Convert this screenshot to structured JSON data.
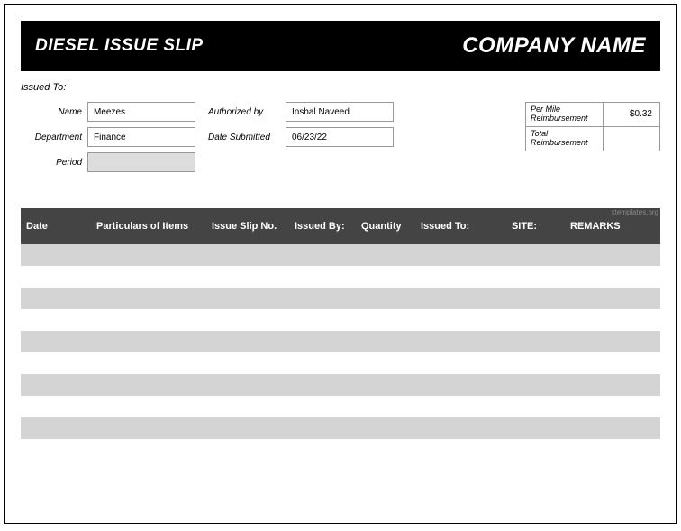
{
  "header": {
    "title": "DIESEL ISSUE SLIP",
    "company": "COMPANY NAME"
  },
  "issued_to_label": "Issued To:",
  "fields": {
    "name_label": "Name",
    "name_value": "Meezes",
    "department_label": "Department",
    "department_value": "Finance",
    "period_label": "Period",
    "period_value": "",
    "authorized_label": "Authorized by",
    "authorized_value": "Inshal Naveed",
    "date_submitted_label": "Date Submitted",
    "date_submitted_value": "06/23/22"
  },
  "reimbursement": {
    "per_mile_label": "Per Mile Reimbursement",
    "per_mile_value": "$0.32",
    "total_label": "Total Reimbursement",
    "total_value": ""
  },
  "watermark": "xtemplates.org",
  "table": {
    "headers": {
      "date": "Date",
      "particulars": "Particulars of Items",
      "slip_no": "Issue Slip No.",
      "issued_by": "Issued By:",
      "quantity": "Quantity",
      "issued_to": "Issued To:",
      "site": "SITE:",
      "remarks": "REMARKS"
    },
    "rows": [
      {},
      {},
      {},
      {},
      {},
      {},
      {},
      {},
      {}
    ]
  },
  "chart_data": {
    "type": "table",
    "title": "DIESEL ISSUE SLIP",
    "categories": [
      "Date",
      "Particulars of Items",
      "Issue Slip No.",
      "Issued By:",
      "Quantity",
      "Issued To:",
      "SITE:",
      "REMARKS"
    ],
    "rows": []
  }
}
